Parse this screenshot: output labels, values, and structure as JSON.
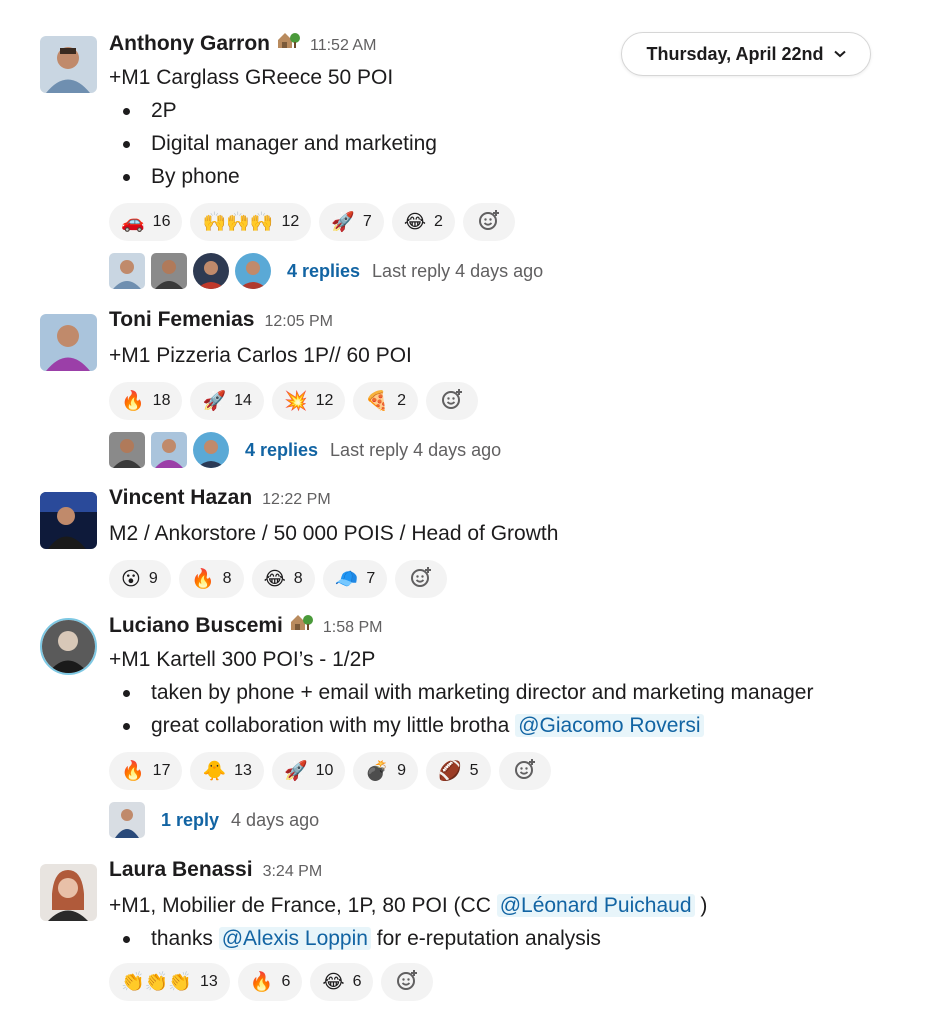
{
  "date_divider": {
    "label": "Thursday, April 22nd",
    "icon": "chevron-down-icon"
  },
  "messages": [
    {
      "author": "Anthony Garron",
      "status_icon": "house-tree-icon",
      "time": "11:52 AM",
      "text": "+M1 Carglass GReece 50 POI",
      "bullets": [
        "2P",
        "Digital manager and marketing",
        "By phone"
      ],
      "reactions": [
        {
          "emoji": "🚗",
          "count": "16"
        },
        {
          "emoji": "🙌🙌🙌",
          "count": "12"
        },
        {
          "emoji": "🚀",
          "count": "7"
        },
        {
          "emoji": "😂",
          "count": "2"
        }
      ],
      "thread": {
        "replies": "4 replies",
        "last": "Last reply 4 days ago"
      }
    },
    {
      "author": "Toni Femenias",
      "time": "12:05 PM",
      "text": "+M1 Pizzeria Carlos 1P// 60 POI",
      "reactions": [
        {
          "emoji": "🔥",
          "count": "18"
        },
        {
          "emoji": "🚀",
          "count": "14"
        },
        {
          "emoji": "💥",
          "count": "12"
        },
        {
          "emoji": "🍕",
          "count": "2"
        }
      ],
      "thread": {
        "replies": "4 replies",
        "last": "Last reply 4 days ago"
      }
    },
    {
      "author": "Vincent Hazan",
      "time": "12:22 PM",
      "text": "M2 / Ankorstore / 50 000 POIS / Head of Growth",
      "reactions": [
        {
          "emoji": "😮",
          "count": "9"
        },
        {
          "emoji": "🔥",
          "count": "8"
        },
        {
          "emoji": "😂",
          "count": "8"
        },
        {
          "emoji": "🧢",
          "count": "7"
        }
      ]
    },
    {
      "author": "Luciano Buscemi",
      "status_icon": "house-tree-icon",
      "time": "1:58 PM",
      "text": "+M1 Kartell 300 POI’s - 1/2P",
      "bullets": [
        "taken by phone + email with marketing director and marketing manager"
      ],
      "bullet2_prefix": "great collaboration with my little brotha ",
      "bullet2_mention": "@Giacomo Roversi",
      "reactions": [
        {
          "emoji": "🔥",
          "count": "17"
        },
        {
          "emoji": "🐥",
          "count": "13"
        },
        {
          "emoji": "🚀",
          "count": "10"
        },
        {
          "emoji": "💣",
          "count": "9"
        },
        {
          "emoji": "🏈",
          "count": "5"
        }
      ],
      "thread": {
        "replies": "1 reply",
        "last": "4 days ago"
      }
    },
    {
      "author": "Laura Benassi",
      "time": "3:24 PM",
      "text_prefix": "+M1, Mobilier de France, 1P, 80 POI (CC ",
      "text_mention": "@Léonard Puichaud",
      "text_suffix": " )",
      "bullet_prefix": "thanks ",
      "bullet_mention": "@Alexis Loppin",
      "bullet_suffix": " for e-reputation analysis",
      "reactions": [
        {
          "emoji": "👏👏👏",
          "count": "13"
        },
        {
          "emoji": "🔥",
          "count": "6"
        },
        {
          "emoji": "😂",
          "count": "6"
        }
      ]
    }
  ],
  "add_reaction_icon": "add-reaction-icon",
  "colors": {
    "link": "#1264a3",
    "mention_bg": "#e8f5fa",
    "reaction_bg": "#f3f3f3"
  }
}
